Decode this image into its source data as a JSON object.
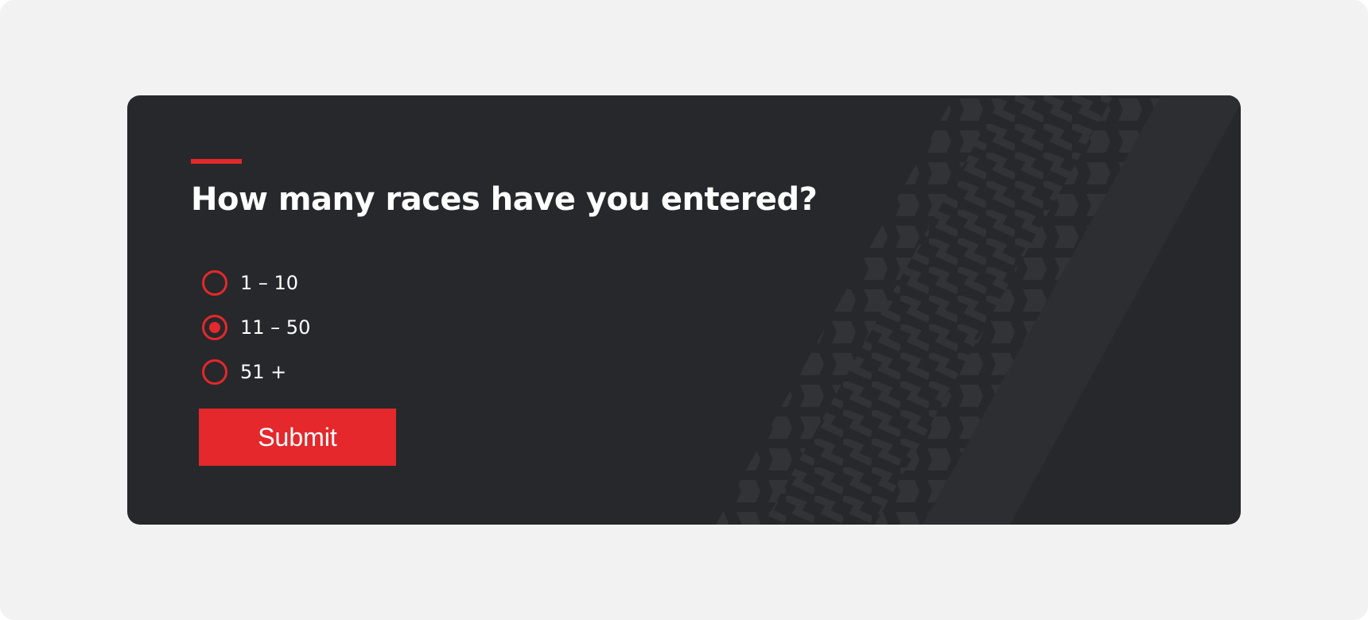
{
  "form": {
    "question": "How many races have you entered?",
    "options": [
      {
        "label": "1 – 10",
        "selected": false
      },
      {
        "label": "11 – 50",
        "selected": true
      },
      {
        "label": "51 +",
        "selected": false
      }
    ],
    "submit_label": "Submit"
  },
  "colors": {
    "page_background": "#f2f2f2",
    "card_background": "#27282b",
    "accent": "#e4282c",
    "text": "#ffffff",
    "tire_tread": "#323336"
  },
  "decoration": {
    "background_graphic": "tire-track-icon"
  }
}
